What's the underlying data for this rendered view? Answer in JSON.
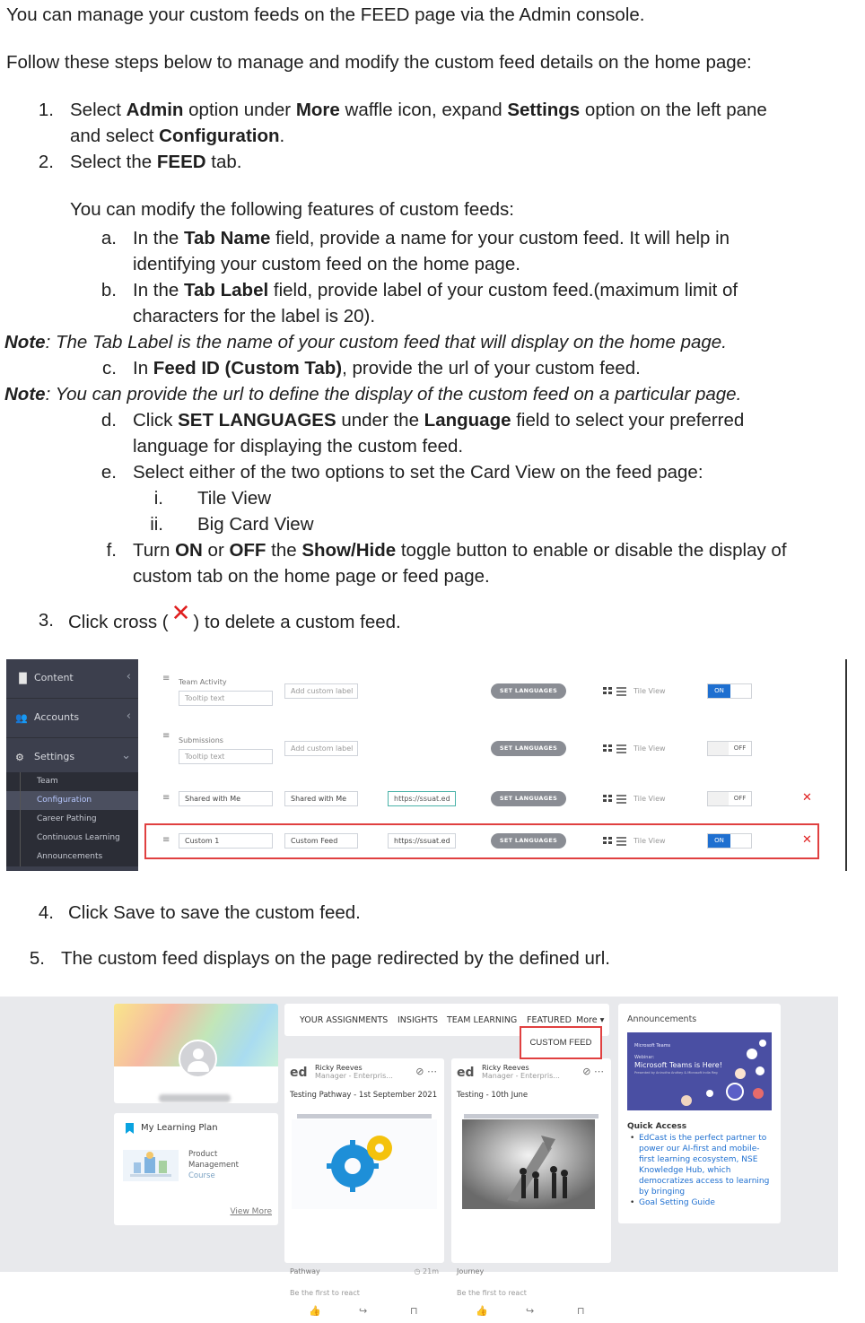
{
  "intro": {
    "line1": "You can manage your custom feeds on the FEED page via the Admin console.",
    "line2": "Follow these steps below to manage and modify the custom feed details on the home page:"
  },
  "steps": {
    "s1_num": "1.",
    "s1_parts": [
      "Select ",
      "Admin",
      " option under ",
      "More",
      " waffle icon, expand ",
      "Settings",
      " option on the left pane"
    ],
    "s1_line2_parts": [
      "and select ",
      "Configuration",
      "."
    ],
    "s2_num": "2.",
    "s2_parts": [
      "Select the ",
      "FEED",
      " tab."
    ],
    "modify_intro": "You can modify the following features of custom feeds:",
    "a_num": "a.",
    "a_parts": [
      "In the ",
      "Tab Name",
      " field, provide a name for your custom feed. It will help in"
    ],
    "a_line2": "identifying your custom feed on the home page.",
    "b_num": "b.",
    "b_parts": [
      "In the ",
      "Tab Label",
      " field, provide label of your custom feed.(maximum limit of"
    ],
    "b_line2": "characters for the label is 20).",
    "note1_label": "Note",
    "note1_text": ": The Tab Label is the name of your custom feed that will display on the home page.",
    "c_num": "c.",
    "c_parts": [
      "In ",
      "Feed ID (Custom Tab)",
      ", provide the url of your custom feed."
    ],
    "note2_label": "Note",
    "note2_text": ": You can provide the url to define the display of the custom feed on a particular page.",
    "d_num": "d.",
    "d_parts": [
      "Click ",
      "SET LANGUAGES",
      " under the ",
      "Language",
      " field to select your preferred"
    ],
    "d_line2": "language for displaying the custom feed.",
    "e_num": "e.",
    "e_text": "Select either of the two options to set the Card View on the feed page:",
    "i_num": "i.",
    "i_text": "Tile View",
    "ii_num": "ii.",
    "ii_text": "Big Card View",
    "f_num": "f.",
    "f_parts": [
      "Turn ",
      "ON",
      " or ",
      "OFF",
      " the  ",
      "Show/Hide",
      " toggle button to enable or disable the display of"
    ],
    "f_line2": "custom tab on the home page or feed page.",
    "s3_num": "3.",
    "s3_before": "Click cross (",
    "s3_x": "✕",
    "s3_after": ") to delete a custom feed.",
    "s4_num": "4.",
    "s4_text": "Click Save to save the custom feed.",
    "s5_num": "5.",
    "s5_text": "The custom feed displays on the page redirected by the defined url."
  },
  "admin": {
    "sidebar": {
      "content": "Content",
      "accounts": "Accounts",
      "settings": "Settings",
      "subitems": [
        "Team",
        "Configuration",
        "Career Pathing",
        "Continuous Learning",
        "Announcements"
      ]
    },
    "rows": [
      {
        "name": "Team Activity",
        "field1": "Tooltip text",
        "label": "Add custom label",
        "url": "",
        "set_lang": "SET LANGUAGES",
        "view": "Tile View",
        "toggle": "ON"
      },
      {
        "name": "Submissions",
        "field1": "Tooltip text",
        "label": "Add custom label",
        "url": "",
        "set_lang": "SET LANGUAGES",
        "view": "Tile View",
        "toggle": "OFF"
      },
      {
        "name": "",
        "field1": "Shared with Me",
        "label": "Shared with Me",
        "url": "https://ssuat.ed",
        "set_lang": "SET LANGUAGES",
        "view": "Tile View",
        "toggle": "OFF",
        "delete": "✕"
      },
      {
        "name": "",
        "field1": "Custom 1",
        "label": "Custom  Feed",
        "url": "https://ssuat.ed",
        "set_lang": "SET LANGUAGES",
        "view": "Tile View",
        "toggle": "ON",
        "delete": "✕"
      }
    ]
  },
  "home": {
    "profile_name": "Shreya Krishna",
    "plan_title": "My Learning Plan",
    "plan_item": [
      "Product",
      "Management",
      "Course"
    ],
    "view_more": "View More",
    "tabs": [
      "YOUR ASSIGNMENTS",
      "INSIGHTS",
      "TEAM LEARNING",
      "FEATURED",
      "More ▾"
    ],
    "custom_feed": "CUSTOM FEED",
    "cards": [
      {
        "author": "Ricky Reeves",
        "role": "Manager - Enterpris...",
        "title": "Testing Pathway - 1st September 2021",
        "kind": "Pathway",
        "duration": "◷ 21m",
        "react": "Be the first to react"
      },
      {
        "author": "Ricky Reeves",
        "role": "Manager - Enterpris...",
        "title": "Testing - 10th June",
        "kind": "Journey",
        "duration": "",
        "react": "Be the first to react"
      }
    ],
    "announcements": {
      "title": "Announcements",
      "img_brand": "Microsoft Teams",
      "img_webinar": "Webinar:",
      "img_headline": "Microsoft Teams is Here!",
      "img_sub": "Presented by Anirudha Andhey & Microsoft India Reg"
    },
    "quick_access": {
      "title": "Quick Access",
      "items": [
        "EdCast is the perfect partner to power our AI-first and mobile-first learning ecosystem, NSE Knowledge Hub, which democratizes access to learning by bringing",
        "Goal Setting Guide"
      ]
    },
    "colors": {
      "accent": "#1e6fd0",
      "highlight": "#e04040",
      "announce_bg": "#4a4fa3"
    }
  }
}
